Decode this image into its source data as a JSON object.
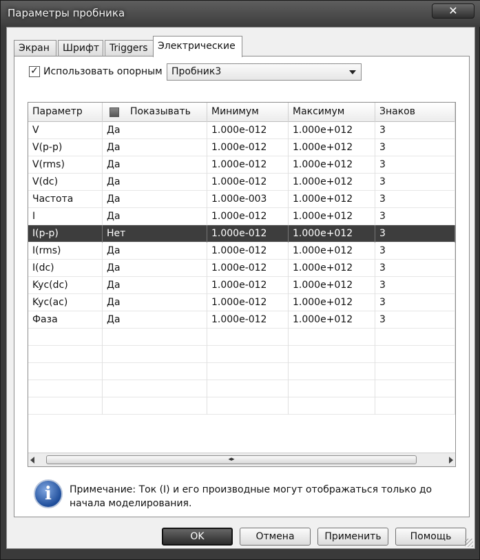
{
  "window": {
    "title": "Параметры пробника",
    "close_glyph": "✕"
  },
  "tabs": [
    {
      "label": "Экран",
      "active": false
    },
    {
      "label": "Шрифт",
      "active": false
    },
    {
      "label": "Triggers",
      "active": false
    },
    {
      "label": "Электрические",
      "active": true
    }
  ],
  "reference": {
    "checkbox_label": "Использовать опорным",
    "checked": true,
    "check_glyph": "✓",
    "dropdown_value": "Пробник3"
  },
  "table": {
    "columns": [
      "Параметр",
      "Показывать",
      "Минимум",
      "Максимум",
      "Знаков"
    ],
    "rows": [
      [
        "V",
        "Да",
        "1.000e-012",
        "1.000e+012",
        "3"
      ],
      [
        "V(p-p)",
        "Да",
        "1.000e-012",
        "1.000e+012",
        "3"
      ],
      [
        "V(rms)",
        "Да",
        "1.000e-012",
        "1.000e+012",
        "3"
      ],
      [
        "V(dc)",
        "Да",
        "1.000e-012",
        "1.000e+012",
        "3"
      ],
      [
        "Частота",
        "Да",
        "1.000e-003",
        "1.000e+012",
        "3"
      ],
      [
        "I",
        "Да",
        "1.000e-012",
        "1.000e+012",
        "3"
      ],
      [
        "I(p-p)",
        "Нет",
        "1.000e-012",
        "1.000e+012",
        "3"
      ],
      [
        "I(rms)",
        "Да",
        "1.000e-012",
        "1.000e+012",
        "3"
      ],
      [
        "I(dc)",
        "Да",
        "1.000e-012",
        "1.000e+012",
        "3"
      ],
      [
        "Kyc(dc)",
        "Да",
        "1.000e-012",
        "1.000e+012",
        "3"
      ],
      [
        "Kyc(ac)",
        "Да",
        "1.000e-012",
        "1.000e+012",
        "3"
      ],
      [
        "Фаза",
        "Да",
        "1.000e-012",
        "1.000e+012",
        "3"
      ]
    ],
    "selected_row": 6,
    "empty_rows": 5
  },
  "note": {
    "text": "Примечание: Ток (I) и его производные могут отображаться только до начала моделирования."
  },
  "buttons": {
    "ok": "OK",
    "cancel": "Отмена",
    "apply": "Применить",
    "help": "Помощь"
  },
  "colors": {
    "selection": "#3d3d3d",
    "info_icon": "#1e4d9a"
  }
}
